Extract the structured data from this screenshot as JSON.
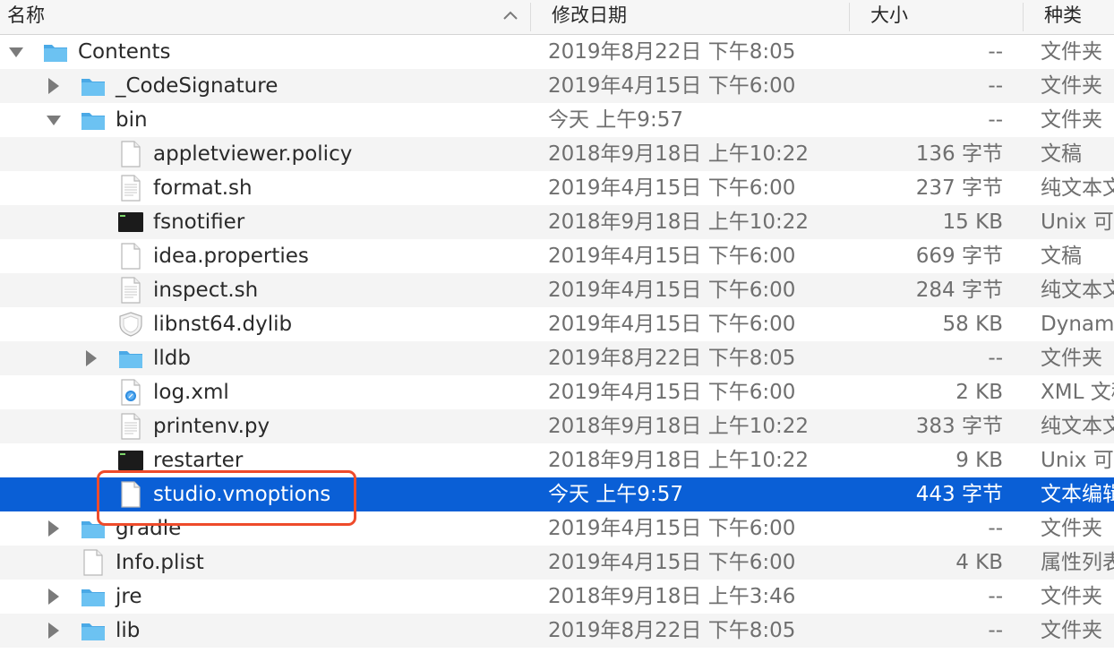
{
  "columns": {
    "name": "名称",
    "date": "修改日期",
    "size": "大小",
    "kind": "种类"
  },
  "colors": {
    "selection": "#0a5fd6",
    "folder": "#5ab8ee",
    "highlight": "#ee4b2b"
  },
  "rows": [
    {
      "name": "Contents",
      "date": "2019年8月22日 下午8:05",
      "size": "--",
      "kind": "文件夹",
      "icon": "folder-icon",
      "disclosure": "expanded"
    },
    {
      "name": "_CodeSignature",
      "date": "2019年4月15日 下午6:00",
      "size": "--",
      "kind": "文件夹",
      "icon": "folder-icon",
      "disclosure": "collapsed"
    },
    {
      "name": "bin",
      "date": "今天 上午9:57",
      "size": "--",
      "kind": "文件夹",
      "icon": "folder-icon",
      "disclosure": "expanded"
    },
    {
      "name": "appletviewer.policy",
      "date": "2018年9月18日 上午10:22",
      "size": "136 字节",
      "kind": "文稿",
      "icon": "document-icon"
    },
    {
      "name": "format.sh",
      "date": "2019年4月15日 下午6:00",
      "size": "237 字节",
      "kind": "纯文本文稿",
      "icon": "text-file-icon"
    },
    {
      "name": "fsnotifier",
      "date": "2018年9月18日 上午10:22",
      "size": "15 KB",
      "kind": "Unix 可执行文件",
      "icon": "terminal-exec-icon"
    },
    {
      "name": "idea.properties",
      "date": "2019年4月15日 下午6:00",
      "size": "669 字节",
      "kind": "文稿",
      "icon": "document-icon"
    },
    {
      "name": "inspect.sh",
      "date": "2019年4月15日 下午6:00",
      "size": "284 字节",
      "kind": "纯文本文稿",
      "icon": "text-file-icon"
    },
    {
      "name": "libnst64.dylib",
      "date": "2019年4月15日 下午6:00",
      "size": "58 KB",
      "kind": "Dynamic Library",
      "icon": "library-shield-icon"
    },
    {
      "name": "lldb",
      "date": "2019年8月22日 下午8:05",
      "size": "--",
      "kind": "文件夹",
      "icon": "folder-icon",
      "disclosure": "collapsed"
    },
    {
      "name": "log.xml",
      "date": "2019年4月15日 下午6:00",
      "size": "2 KB",
      "kind": "XML 文稿",
      "icon": "xml-file-icon"
    },
    {
      "name": "printenv.py",
      "date": "2018年9月18日 上午10:22",
      "size": "383 字节",
      "kind": "纯文本文稿",
      "icon": "text-file-icon"
    },
    {
      "name": "restarter",
      "date": "2018年9月18日 上午10:22",
      "size": "9 KB",
      "kind": "Unix 可执行文件",
      "icon": "terminal-exec-icon"
    },
    {
      "name": "studio.vmoptions",
      "date": "今天 上午9:57",
      "size": "443 字节",
      "kind": "文本编辑文稿",
      "icon": "document-icon"
    },
    {
      "name": "gradle",
      "date": "2019年4月15日 下午6:00",
      "size": "--",
      "kind": "文件夹",
      "icon": "folder-icon",
      "disclosure": "collapsed"
    },
    {
      "name": "Info.plist",
      "date": "2019年4月15日 下午6:00",
      "size": "4 KB",
      "kind": "属性列表",
      "icon": "document-icon"
    },
    {
      "name": "jre",
      "date": "2018年9月18日 上午3:46",
      "size": "--",
      "kind": "文件夹",
      "icon": "folder-icon",
      "disclosure": "collapsed"
    },
    {
      "name": "lib",
      "date": "2019年8月22日 下午8:05",
      "size": "--",
      "kind": "文件夹",
      "icon": "folder-icon",
      "disclosure": "collapsed"
    }
  ]
}
